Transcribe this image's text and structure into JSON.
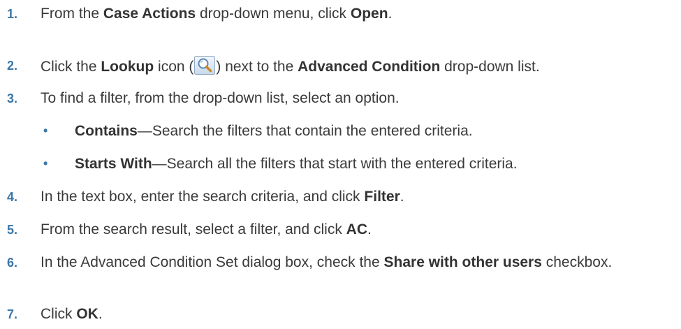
{
  "steps": [
    {
      "number": "1.",
      "parts": [
        "From the ",
        "Case Actions",
        " drop-down menu, click ",
        "Open",
        "."
      ]
    },
    {
      "number": "2.",
      "parts": [
        "Click the ",
        "Lookup",
        " icon (",
        ") next to the ",
        "Advanced Condition",
        " drop-down list."
      ],
      "icon": "lookup-magnifier-icon"
    },
    {
      "number": "3.",
      "parts": [
        "To find a filter, from the drop-down list, select an option."
      ],
      "bullets": [
        {
          "term": "Contains",
          "text": "—Search the filters that contain the entered criteria."
        },
        {
          "term": "Starts With",
          "text": "—Search all the filters that start with the entered criteria."
        }
      ]
    },
    {
      "number": "4.",
      "parts": [
        "In the text box, enter the search criteria, and click ",
        "Filter",
        "."
      ]
    },
    {
      "number": "5.",
      "parts": [
        "From the search result, select a filter, and click ",
        "AC",
        "."
      ]
    },
    {
      "number": "6.",
      "parts": [
        "In the Advanced Condition Set dialog box, check the ",
        "Share with other users",
        " checkbox."
      ]
    },
    {
      "number": "7.",
      "parts": [
        "Click ",
        "OK",
        "."
      ]
    }
  ],
  "colors": {
    "step_number": "#3b77a8",
    "text": "#3a3a3a"
  }
}
